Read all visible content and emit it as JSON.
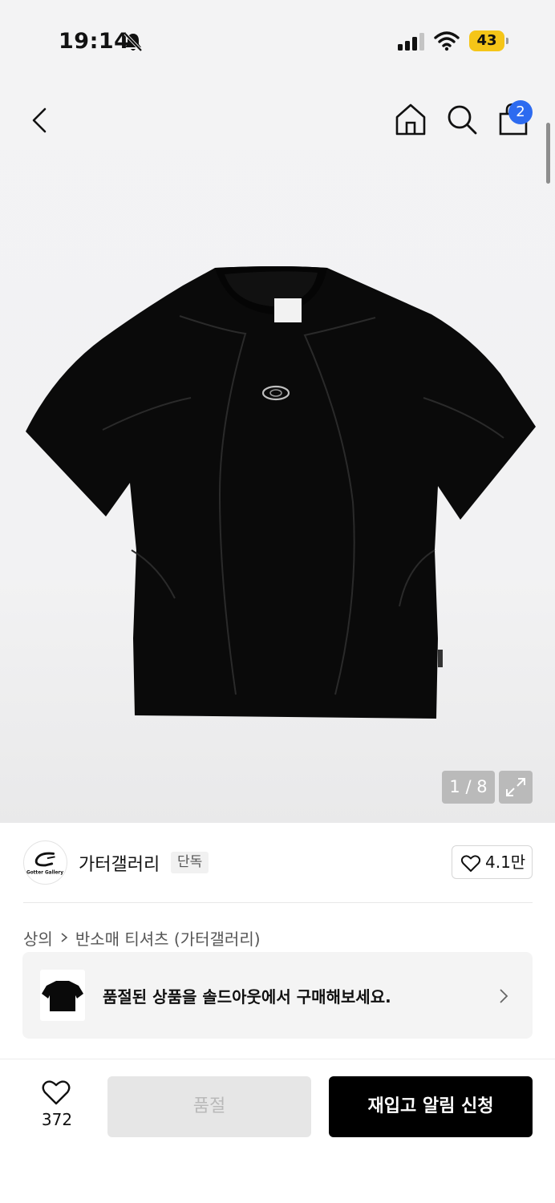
{
  "status_bar": {
    "time": "19:14",
    "battery": "43"
  },
  "nav": {
    "cart_count": "2"
  },
  "gallery": {
    "counter": "1 / 8"
  },
  "brand": {
    "name": "가터갤러리",
    "badge": "단독",
    "likes": "4.1만",
    "logo_text": "Gotter Gallery"
  },
  "breadcrumb": [
    "상의",
    "반소매 티셔츠 (가터갤러리)"
  ],
  "soldout_banner": {
    "text": "품절된 상품을 솔드아웃에서 구매해보세요."
  },
  "bottom_bar": {
    "wish_count": "372",
    "soldout_label": "품절",
    "restock_label": "재입고 알림 신청"
  },
  "colors": {
    "accent": "#2d6bf0",
    "battery": "#f5c518",
    "primary_button": "#000000",
    "disabled_button": "#e6e6e6"
  }
}
